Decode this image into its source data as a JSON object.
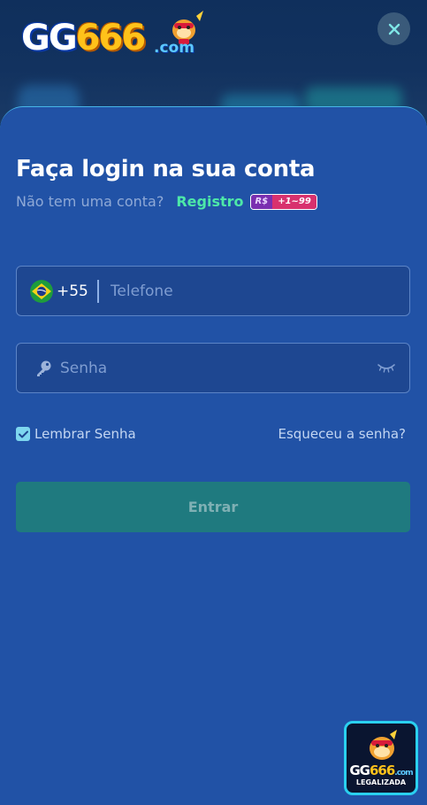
{
  "brand": {
    "logo_prefix": "GG",
    "logo_number": "666",
    "logo_suffix": ".com"
  },
  "modal": {
    "title": "Faça login na sua conta",
    "no_account_text": "Não tem uma conta?",
    "register_link": "Registro",
    "register_badge_currency": "R$",
    "register_badge_amount": "+1~99"
  },
  "form": {
    "country_code": "+55",
    "phone_placeholder": "Telefone",
    "password_placeholder": "Senha",
    "remember_label": "Lembrar Senha",
    "remember_checked": true,
    "forgot_link": "Esqueceu a senha?",
    "submit_label": "Entrar"
  },
  "floating_badge": {
    "logo_prefix": "GG",
    "logo_number": "666",
    "logo_suffix": ".com",
    "subtitle": "LEGALIZADA"
  },
  "colors": {
    "modal_bg": "#2152a6",
    "accent_green": "#4de8a8",
    "submit_bg": "#1f7a7f"
  }
}
